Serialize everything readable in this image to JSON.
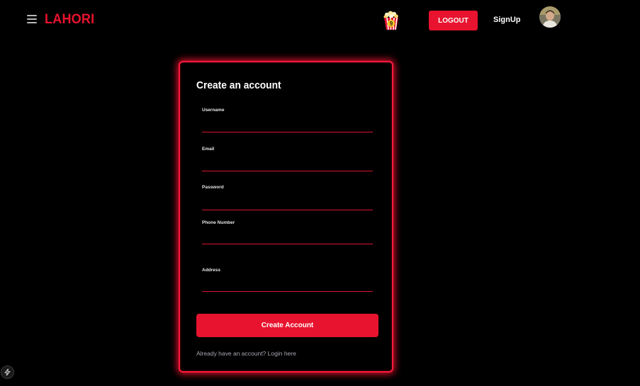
{
  "header": {
    "brand": "LAHORI",
    "logout_label": "LOGOUT",
    "signup_label": "SignUp",
    "popcorn_badge": "9"
  },
  "form": {
    "title": "Create an account",
    "fields": [
      {
        "label": "Username",
        "value": ""
      },
      {
        "label": "Email",
        "value": ""
      },
      {
        "label": "Password",
        "value": ""
      },
      {
        "label": "Phone Number",
        "value": ""
      },
      {
        "label": "Address",
        "value": ""
      }
    ],
    "submit_label": "Create Account",
    "login_prompt": "Already have an account? ",
    "login_link": "Login here"
  },
  "colors": {
    "accent": "#e8132e",
    "glow": "#ff1a3a",
    "background": "#000000"
  },
  "icons": {
    "menu": "hamburger-icon",
    "popcorn": "popcorn-icon",
    "avatar": "user-avatar",
    "dev_badge": "lightning-icon"
  }
}
